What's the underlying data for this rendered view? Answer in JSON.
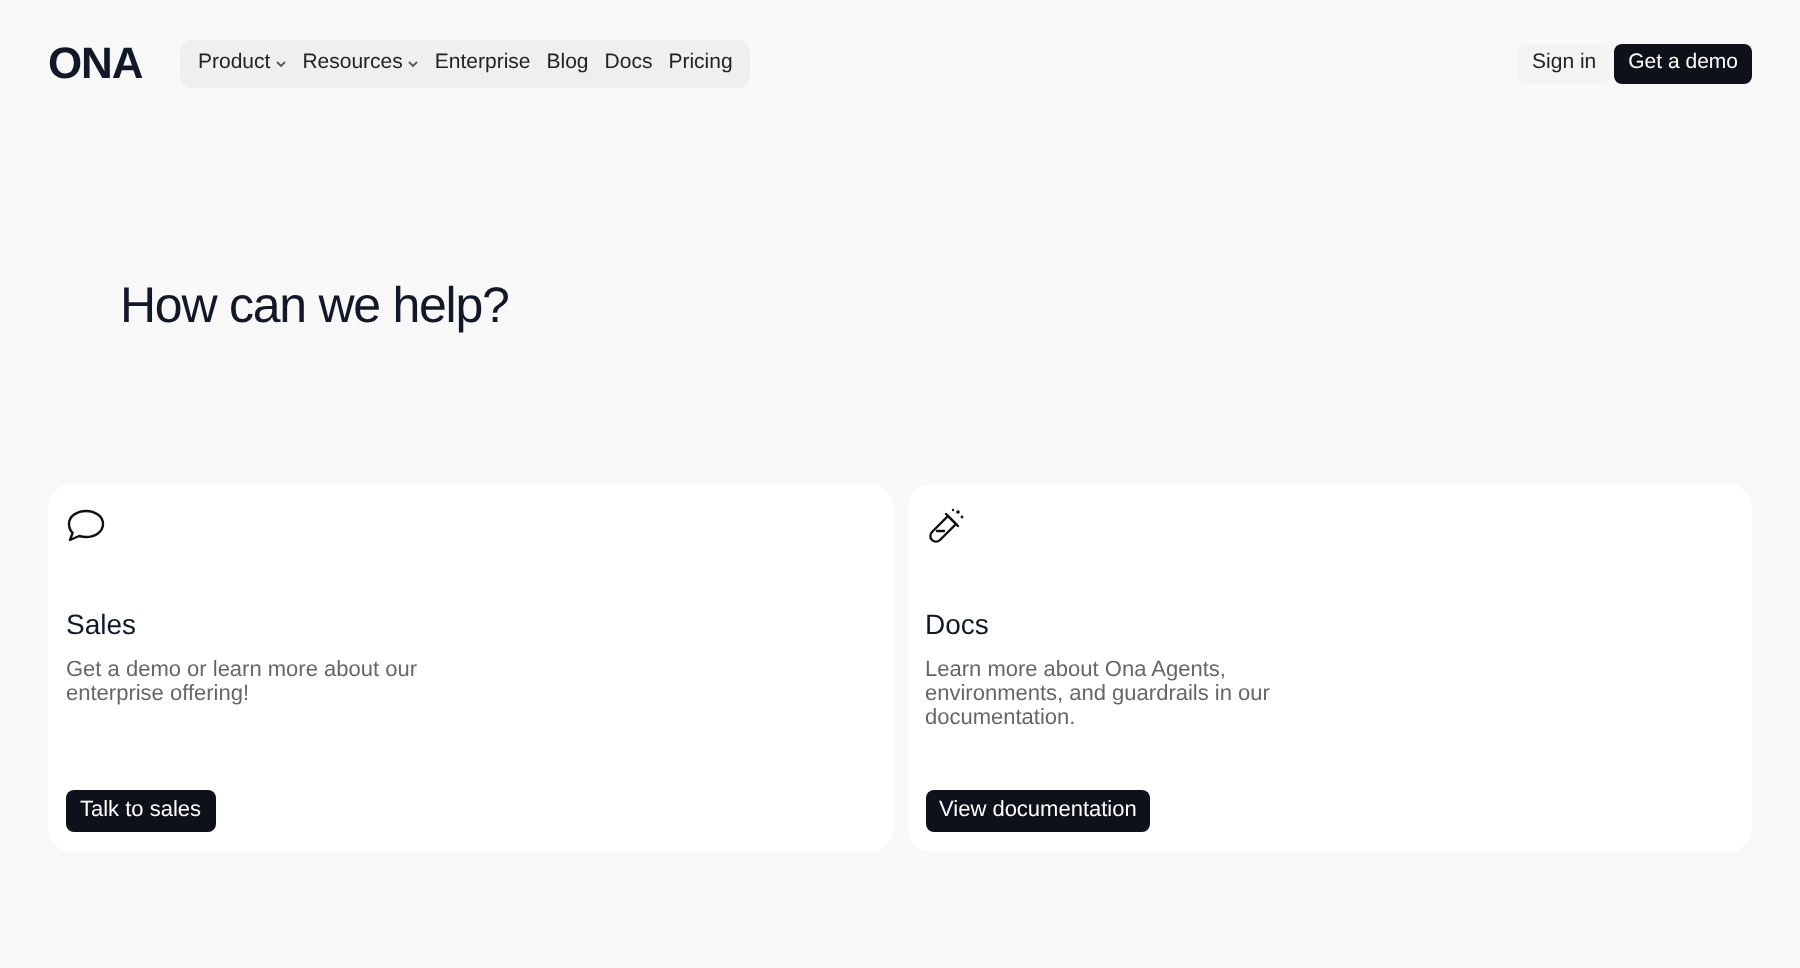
{
  "logo": "ONA",
  "nav": [
    {
      "label": "Product",
      "kind": "dropdown"
    },
    {
      "label": "Resources",
      "kind": "dropdown"
    },
    {
      "label": "Enterprise",
      "kind": "link"
    },
    {
      "label": "Blog",
      "kind": "link"
    },
    {
      "label": "Docs",
      "kind": "link"
    },
    {
      "label": "Pricing",
      "kind": "link"
    }
  ],
  "actions": [
    {
      "label": "Sign in",
      "kind": "secondary"
    },
    {
      "label": "Get a demo",
      "kind": "primary"
    }
  ],
  "heading": "How can we help?",
  "cards": [
    {
      "title": "Sales",
      "description": "Get a demo or learn more about our enterprise offering!",
      "button": "Talk to sales"
    },
    {
      "title": "Docs",
      "description": "Learn more about Ona Agents, environments, and guardrails in our documentation.",
      "button": "View documentation"
    }
  ]
}
